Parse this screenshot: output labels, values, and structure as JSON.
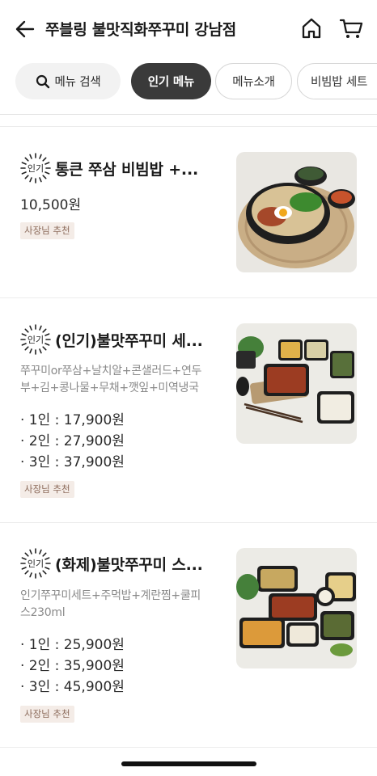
{
  "header": {
    "title": "쭈블링 불맛직화쭈꾸미 강남점"
  },
  "chips": {
    "search_label": "메뉴 검색",
    "items": [
      "인기 메뉴",
      "메뉴소개",
      "비빔밥 세트"
    ]
  },
  "badge_text": "인기",
  "items": [
    {
      "name": "통큰 쭈삼 비빔밥  +...",
      "price": "10,500원",
      "tag": "사장님 추천"
    },
    {
      "name": "(인기)불맛쭈꾸미 세...",
      "desc_line1": "쭈꾸미or쭈삼+날치알+콘샐러드+연두",
      "desc_line2": "부+김+콩나물+무채+깻잎+미역냉국",
      "prices": [
        "· 1인 : 17,900원",
        "· 2인 : 27,900원",
        "· 3인 : 37,900원"
      ],
      "tag": "사장님 추천"
    },
    {
      "name": "(화제)불맛쭈꾸미 스...",
      "desc_line1": "인기쭈꾸미세트+주먹밥+계란찜+쿨피",
      "desc_line2": "스230ml",
      "prices": [
        "· 1인 : 25,900원",
        "· 2인 : 35,900원",
        "· 3인 : 45,900원"
      ],
      "tag": "사장님 추천"
    }
  ]
}
